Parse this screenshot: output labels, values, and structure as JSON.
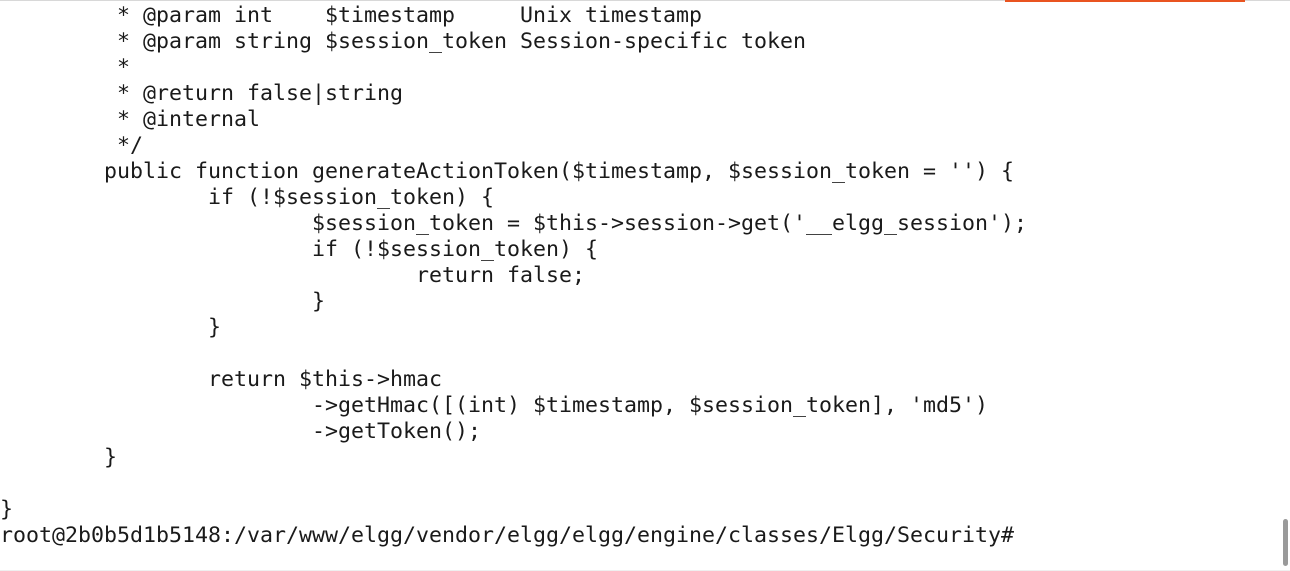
{
  "terminal": {
    "lines": [
      "         * @param int    $timestamp     Unix timestamp",
      "         * @param string $session_token Session-specific token",
      "         *",
      "         * @return false|string",
      "         * @internal",
      "         */",
      "        public function generateActionToken($timestamp, $session_token = '') {",
      "                if (!$session_token) {",
      "                        $session_token = $this->session->get('__elgg_session');",
      "                        if (!$session_token) {",
      "                                return false;",
      "                        }",
      "                }",
      "",
      "                return $this->hmac",
      "                        ->getHmac([(int) $timestamp, $session_token], 'md5')",
      "                        ->getToken();",
      "        }",
      "",
      "}"
    ],
    "prompt": "root@2b0b5d1b5148:/var/www/elgg/vendor/elgg/elgg/engine/classes/Elgg/Security#"
  },
  "colors": {
    "background": "#ffffff",
    "text": "#1a1a1a",
    "accent": "#e95420",
    "scroll_thumb": "#9a9a9a"
  }
}
